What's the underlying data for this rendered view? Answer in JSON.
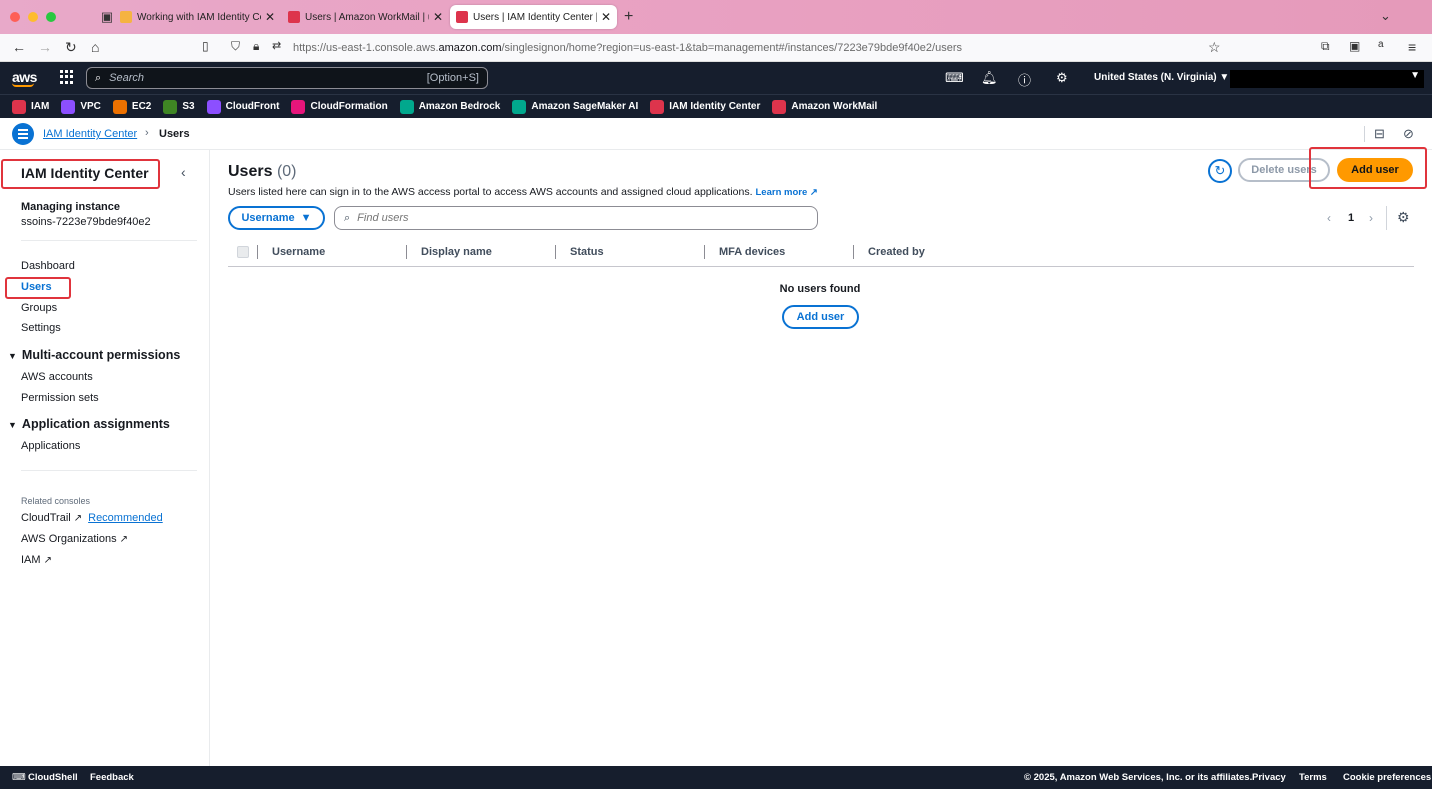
{
  "browser": {
    "tabs": [
      {
        "title": "Working with IAM Identity Cente",
        "color": "#f5b342"
      },
      {
        "title": "Users | Amazon WorkMail | us-e",
        "color": "#dd344c"
      },
      {
        "title": "Users | IAM Identity Center | us-",
        "color": "#dd344c",
        "active": true
      }
    ],
    "url_prefix": "https://us-east-1.console.aws.",
    "url_host": "amazon.com",
    "url_path": "/singlesignon/home?region=us-east-1&tab=management#/instances/7223e79bde9f40e2/users"
  },
  "aws_nav": {
    "logo": "aws",
    "search_placeholder": "Search",
    "search_shortcut": "[Option+S]",
    "region": "United States (N. Virginia) ▼"
  },
  "favorites": [
    {
      "label": "IAM",
      "color": "#dd344c"
    },
    {
      "label": "VPC",
      "color": "#8c4fff"
    },
    {
      "label": "EC2",
      "color": "#ed7100"
    },
    {
      "label": "S3",
      "color": "#3f8624"
    },
    {
      "label": "CloudFront",
      "color": "#8c4fff"
    },
    {
      "label": "CloudFormation",
      "color": "#e7157b"
    },
    {
      "label": "Amazon Bedrock",
      "color": "#01a88d"
    },
    {
      "label": "Amazon SageMaker AI",
      "color": "#01a88d"
    },
    {
      "label": "IAM Identity Center",
      "color": "#dd344c"
    },
    {
      "label": "Amazon WorkMail",
      "color": "#dd344c"
    }
  ],
  "breadcrumb": {
    "parent": "IAM Identity Center",
    "current": "Users"
  },
  "sidenav": {
    "title": "IAM Identity Center",
    "managing_label": "Managing instance",
    "instance": "ssoins-7223e79bde9f40e2",
    "items": [
      "Dashboard",
      "Users",
      "Groups",
      "Settings"
    ],
    "section1": "Multi-account permissions",
    "section1_items": [
      "AWS accounts",
      "Permission sets"
    ],
    "section2": "Application assignments",
    "section2_items": [
      "Applications"
    ],
    "related_label": "Related consoles",
    "related": [
      "CloudTrail",
      "AWS Organizations",
      "IAM"
    ],
    "recommended": "Recommended"
  },
  "main": {
    "title": "Users",
    "count": "(0)",
    "description": "Users listed here can sign in to the AWS access portal to access AWS accounts and assigned cloud applications.",
    "learn_more": "Learn more",
    "delete_label": "Delete users",
    "add_label": "Add user",
    "filter_property": "Username",
    "find_placeholder": "Find users",
    "page": "1",
    "columns": [
      "Username",
      "Display name",
      "Status",
      "MFA devices",
      "Created by"
    ],
    "empty_text": "No users found",
    "empty_button": "Add user"
  },
  "footer": {
    "cloudshell": "CloudShell",
    "feedback": "Feedback",
    "copyright": "© 2025, Amazon Web Services, Inc. or its affiliates.",
    "privacy": "Privacy",
    "terms": "Terms",
    "cookies": "Cookie preferences"
  }
}
